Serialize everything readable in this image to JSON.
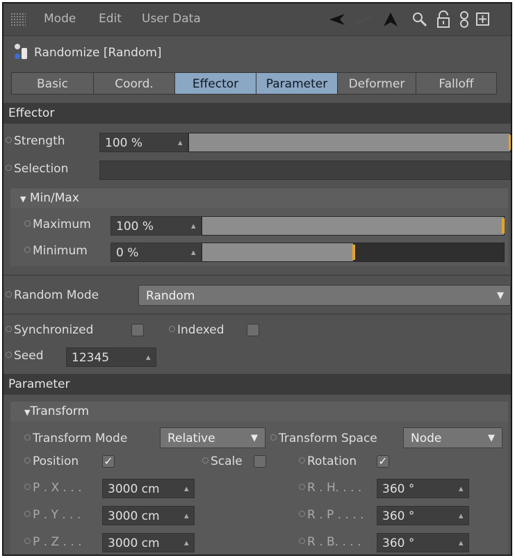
{
  "menubar": {
    "items": [
      "Mode",
      "Edit",
      "User Data"
    ],
    "icons": [
      "back-arrow-icon",
      "up-arrow-icon",
      "search-icon",
      "lock-icon",
      "link-icon",
      "new-panel-icon"
    ]
  },
  "object": {
    "title": "Randomize [Random]"
  },
  "tabs": [
    {
      "label": "Basic",
      "active": false
    },
    {
      "label": "Coord.",
      "active": false
    },
    {
      "label": "Effector",
      "active": true
    },
    {
      "label": "Parameter",
      "active": true
    },
    {
      "label": "Deformer",
      "active": false
    },
    {
      "label": "Falloff",
      "active": false
    }
  ],
  "effector": {
    "header": "Effector",
    "strength": {
      "label": "Strength",
      "value": "100 %",
      "fraction": 1.0
    },
    "selection": {
      "label": "Selection",
      "value": ""
    },
    "minmax": {
      "header": "Min/Max",
      "maximum": {
        "label": "Maximum",
        "value": "100 %",
        "fraction": 1.0
      },
      "minimum": {
        "label": "Minimum",
        "value": "0 %",
        "fraction": 0.5
      }
    },
    "random_mode": {
      "label": "Random Mode",
      "value": "Random"
    },
    "synchronized": {
      "label": "Synchronized",
      "checked": false
    },
    "indexed": {
      "label": "Indexed",
      "checked": false
    },
    "seed": {
      "label": "Seed",
      "value": "12345"
    }
  },
  "parameter": {
    "header": "Parameter",
    "transform": {
      "header": "Transform",
      "transform_mode": {
        "label": "Transform Mode",
        "value": "Relative"
      },
      "transform_space": {
        "label": "Transform Space",
        "value": "Node"
      },
      "position": {
        "label": "Position",
        "checked": true
      },
      "scale": {
        "label": "Scale",
        "checked": false
      },
      "rotation": {
        "label": "Rotation",
        "checked": true
      },
      "px": {
        "label": "P . X . . .",
        "value": "3000 cm"
      },
      "py": {
        "label": "P . Y . . .",
        "value": "3000 cm"
      },
      "pz": {
        "label": "P . Z . . .",
        "value": "3000 cm"
      },
      "rh": {
        "label": "R . H. . . .",
        "value": "360 °"
      },
      "rp": {
        "label": "R . P . . . .",
        "value": "360 °"
      },
      "rb": {
        "label": "R . B. . . .",
        "value": "360 °"
      }
    }
  },
  "colors": {
    "panel_bg": "#525252",
    "section_bg": "#3b3b3b",
    "tab_active": "#8aa7c4",
    "slider_handle": "#e4a42a"
  }
}
